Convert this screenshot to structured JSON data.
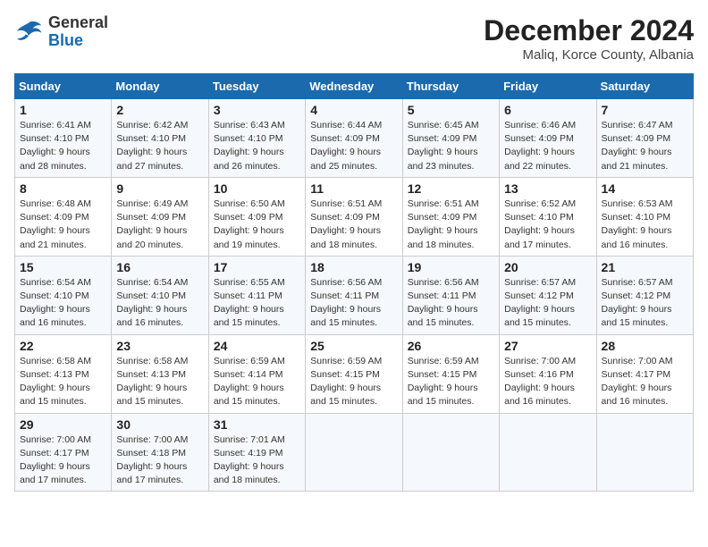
{
  "header": {
    "logo_general": "General",
    "logo_blue": "Blue",
    "month_title": "December 2024",
    "location": "Maliq, Korce County, Albania"
  },
  "weekdays": [
    "Sunday",
    "Monday",
    "Tuesday",
    "Wednesday",
    "Thursday",
    "Friday",
    "Saturday"
  ],
  "weeks": [
    [
      {
        "day": 1,
        "sunrise": "6:41 AM",
        "sunset": "4:10 PM",
        "daylight": "9 hours and 28 minutes."
      },
      {
        "day": 2,
        "sunrise": "6:42 AM",
        "sunset": "4:10 PM",
        "daylight": "9 hours and 27 minutes."
      },
      {
        "day": 3,
        "sunrise": "6:43 AM",
        "sunset": "4:10 PM",
        "daylight": "9 hours and 26 minutes."
      },
      {
        "day": 4,
        "sunrise": "6:44 AM",
        "sunset": "4:09 PM",
        "daylight": "9 hours and 25 minutes."
      },
      {
        "day": 5,
        "sunrise": "6:45 AM",
        "sunset": "4:09 PM",
        "daylight": "9 hours and 23 minutes."
      },
      {
        "day": 6,
        "sunrise": "6:46 AM",
        "sunset": "4:09 PM",
        "daylight": "9 hours and 22 minutes."
      },
      {
        "day": 7,
        "sunrise": "6:47 AM",
        "sunset": "4:09 PM",
        "daylight": "9 hours and 21 minutes."
      }
    ],
    [
      {
        "day": 8,
        "sunrise": "6:48 AM",
        "sunset": "4:09 PM",
        "daylight": "9 hours and 21 minutes."
      },
      {
        "day": 9,
        "sunrise": "6:49 AM",
        "sunset": "4:09 PM",
        "daylight": "9 hours and 20 minutes."
      },
      {
        "day": 10,
        "sunrise": "6:50 AM",
        "sunset": "4:09 PM",
        "daylight": "9 hours and 19 minutes."
      },
      {
        "day": 11,
        "sunrise": "6:51 AM",
        "sunset": "4:09 PM",
        "daylight": "9 hours and 18 minutes."
      },
      {
        "day": 12,
        "sunrise": "6:51 AM",
        "sunset": "4:09 PM",
        "daylight": "9 hours and 18 minutes."
      },
      {
        "day": 13,
        "sunrise": "6:52 AM",
        "sunset": "4:10 PM",
        "daylight": "9 hours and 17 minutes."
      },
      {
        "day": 14,
        "sunrise": "6:53 AM",
        "sunset": "4:10 PM",
        "daylight": "9 hours and 16 minutes."
      }
    ],
    [
      {
        "day": 15,
        "sunrise": "6:54 AM",
        "sunset": "4:10 PM",
        "daylight": "9 hours and 16 minutes."
      },
      {
        "day": 16,
        "sunrise": "6:54 AM",
        "sunset": "4:10 PM",
        "daylight": "9 hours and 16 minutes."
      },
      {
        "day": 17,
        "sunrise": "6:55 AM",
        "sunset": "4:11 PM",
        "daylight": "9 hours and 15 minutes."
      },
      {
        "day": 18,
        "sunrise": "6:56 AM",
        "sunset": "4:11 PM",
        "daylight": "9 hours and 15 minutes."
      },
      {
        "day": 19,
        "sunrise": "6:56 AM",
        "sunset": "4:11 PM",
        "daylight": "9 hours and 15 minutes."
      },
      {
        "day": 20,
        "sunrise": "6:57 AM",
        "sunset": "4:12 PM",
        "daylight": "9 hours and 15 minutes."
      },
      {
        "day": 21,
        "sunrise": "6:57 AM",
        "sunset": "4:12 PM",
        "daylight": "9 hours and 15 minutes."
      }
    ],
    [
      {
        "day": 22,
        "sunrise": "6:58 AM",
        "sunset": "4:13 PM",
        "daylight": "9 hours and 15 minutes."
      },
      {
        "day": 23,
        "sunrise": "6:58 AM",
        "sunset": "4:13 PM",
        "daylight": "9 hours and 15 minutes."
      },
      {
        "day": 24,
        "sunrise": "6:59 AM",
        "sunset": "4:14 PM",
        "daylight": "9 hours and 15 minutes."
      },
      {
        "day": 25,
        "sunrise": "6:59 AM",
        "sunset": "4:15 PM",
        "daylight": "9 hours and 15 minutes."
      },
      {
        "day": 26,
        "sunrise": "6:59 AM",
        "sunset": "4:15 PM",
        "daylight": "9 hours and 15 minutes."
      },
      {
        "day": 27,
        "sunrise": "7:00 AM",
        "sunset": "4:16 PM",
        "daylight": "9 hours and 16 minutes."
      },
      {
        "day": 28,
        "sunrise": "7:00 AM",
        "sunset": "4:17 PM",
        "daylight": "9 hours and 16 minutes."
      }
    ],
    [
      {
        "day": 29,
        "sunrise": "7:00 AM",
        "sunset": "4:17 PM",
        "daylight": "9 hours and 17 minutes."
      },
      {
        "day": 30,
        "sunrise": "7:00 AM",
        "sunset": "4:18 PM",
        "daylight": "9 hours and 17 minutes."
      },
      {
        "day": 31,
        "sunrise": "7:01 AM",
        "sunset": "4:19 PM",
        "daylight": "9 hours and 18 minutes."
      },
      null,
      null,
      null,
      null
    ]
  ]
}
